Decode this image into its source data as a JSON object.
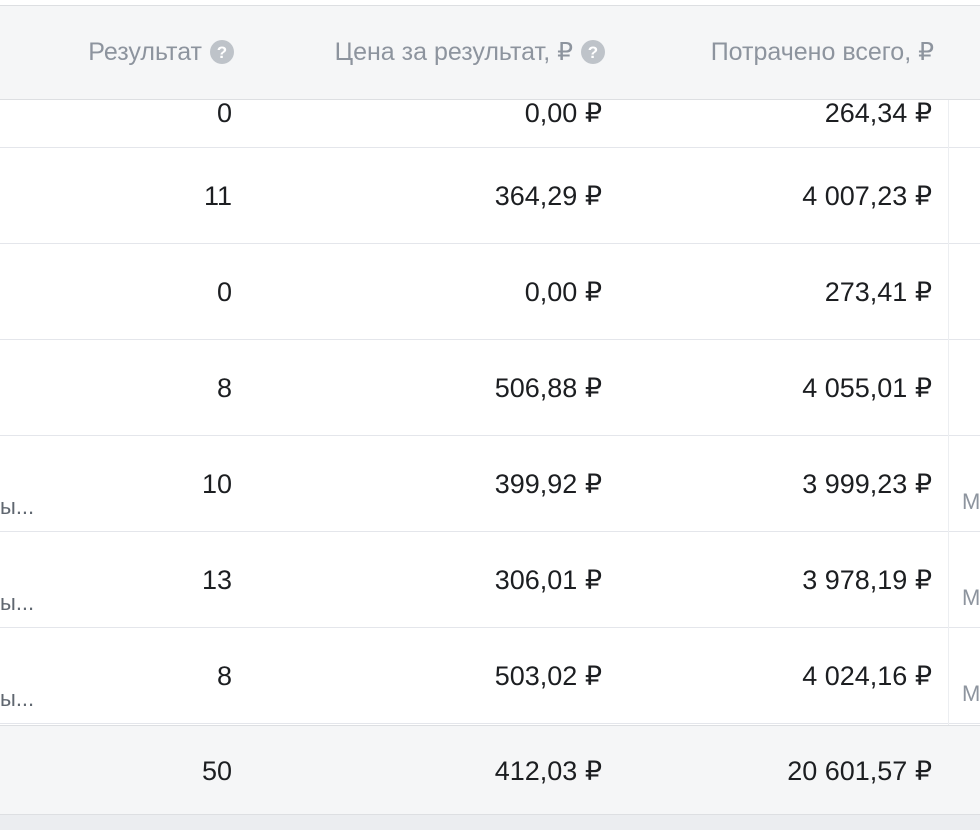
{
  "header": {
    "result_label": "Результат",
    "cost_label": "Цена за результат, ₽",
    "spent_label": "Потрачено всего, ₽",
    "help_glyph": "?"
  },
  "rows": [
    {
      "result": "0",
      "cost": "0,00 ₽",
      "spent": "264,34 ₽",
      "left_text": "",
      "right_text": ""
    },
    {
      "result": "11",
      "cost": "364,29 ₽",
      "spent": "4 007,23 ₽",
      "left_text": "",
      "right_text": ""
    },
    {
      "result": "0",
      "cost": "0,00 ₽",
      "spent": "273,41 ₽",
      "left_text": "",
      "right_text": ""
    },
    {
      "result": "8",
      "cost": "506,88 ₽",
      "spent": "4 055,01 ₽",
      "left_text": "",
      "right_text": ""
    },
    {
      "result": "10",
      "cost": "399,92 ₽",
      "spent": "3 999,23 ₽",
      "left_text": "ы...",
      "right_text": "М"
    },
    {
      "result": "13",
      "cost": "306,01 ₽",
      "spent": "3 978,19 ₽",
      "left_text": "ы...",
      "right_text": "М"
    },
    {
      "result": "8",
      "cost": "503,02 ₽",
      "spent": "4 024,16 ₽",
      "left_text": "ы...",
      "right_text": "М"
    }
  ],
  "totals": {
    "result": "50",
    "cost": "412,03 ₽",
    "spent": "20 601,57 ₽"
  }
}
